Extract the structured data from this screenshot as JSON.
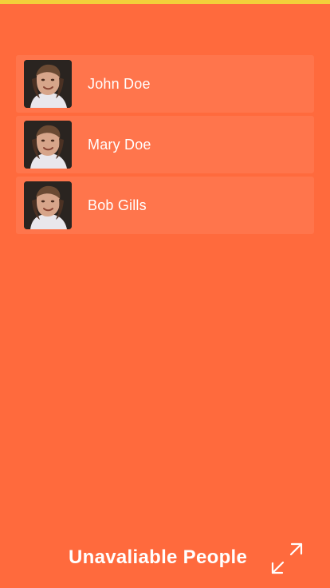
{
  "colors": {
    "background": "#FF6A3D",
    "top_bar": "#F2D03B",
    "text": "#FFFFFF"
  },
  "people": [
    {
      "name": "John Doe",
      "avatar": "person-photo"
    },
    {
      "name": "Mary Doe",
      "avatar": "person-photo"
    },
    {
      "name": "Bob Gills",
      "avatar": "person-photo"
    }
  ],
  "footer": {
    "label": "Unavaliable People",
    "icon": "collapse-arrows-icon"
  }
}
